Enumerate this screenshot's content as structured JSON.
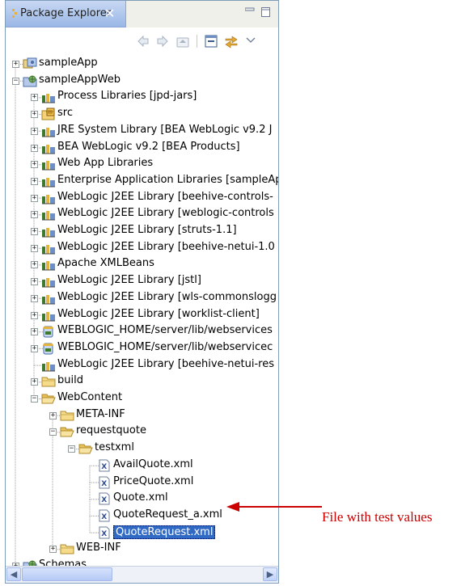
{
  "view": {
    "title": "Package Explorer",
    "close_glyph": "✕"
  },
  "colors": {
    "selection": "#316ac5",
    "annotation": "#cc0000",
    "folder": "#e9c15b",
    "library": "#3d7a2c"
  },
  "toolbar": {
    "icons": [
      "back-arrow-icon",
      "forward-arrow-icon",
      "up-folder-icon",
      "collapse-all-icon",
      "link-with-editor-icon",
      "view-menu-icon"
    ]
  },
  "tree": {
    "items": [
      {
        "label": "sampleApp",
        "depth": 0,
        "expander": "+",
        "icon": "ear-project-icon"
      },
      {
        "label": "sampleAppWeb",
        "depth": 0,
        "expander": "-",
        "icon": "web-project-icon"
      },
      {
        "label": "Process Libraries [jpd-jars]",
        "depth": 1,
        "expander": "+",
        "icon": "library-icon"
      },
      {
        "label": "src",
        "depth": 1,
        "expander": "+",
        "icon": "source-folder-icon"
      },
      {
        "label": "JRE System Library [BEA WebLogic v9.2 J",
        "depth": 1,
        "expander": "+",
        "icon": "library-icon"
      },
      {
        "label": "BEA WebLogic v9.2 [BEA Products]",
        "depth": 1,
        "expander": "+",
        "icon": "library-icon"
      },
      {
        "label": "Web App Libraries",
        "depth": 1,
        "expander": "+",
        "icon": "library-icon"
      },
      {
        "label": "Enterprise Application Libraries [sampleAp",
        "depth": 1,
        "expander": "+",
        "icon": "library-icon"
      },
      {
        "label": "WebLogic J2EE Library [beehive-controls-",
        "depth": 1,
        "expander": "+",
        "icon": "library-icon"
      },
      {
        "label": "WebLogic J2EE Library [weblogic-controls",
        "depth": 1,
        "expander": "+",
        "icon": "library-icon"
      },
      {
        "label": "WebLogic J2EE Library [struts-1.1]",
        "depth": 1,
        "expander": "+",
        "icon": "library-icon"
      },
      {
        "label": "WebLogic J2EE Library [beehive-netui-1.0",
        "depth": 1,
        "expander": "+",
        "icon": "library-icon"
      },
      {
        "label": "Apache XMLBeans",
        "depth": 1,
        "expander": "+",
        "icon": "library-icon"
      },
      {
        "label": "WebLogic J2EE Library [jstl]",
        "depth": 1,
        "expander": "+",
        "icon": "library-icon"
      },
      {
        "label": "WebLogic J2EE Library [wls-commonslogg",
        "depth": 1,
        "expander": "+",
        "icon": "library-icon"
      },
      {
        "label": "WebLogic J2EE Library [worklist-client]",
        "depth": 1,
        "expander": "+",
        "icon": "library-icon"
      },
      {
        "label": "WEBLOGIC_HOME/server/lib/webservices",
        "depth": 1,
        "expander": "+",
        "icon": "jar-icon"
      },
      {
        "label": "WEBLOGIC_HOME/server/lib/webservicec",
        "depth": 1,
        "expander": "+",
        "icon": "jar-icon"
      },
      {
        "label": "WebLogic J2EE Library [beehive-netui-res",
        "depth": 1,
        "expander": "",
        "icon": "library-icon"
      },
      {
        "label": "build",
        "depth": 1,
        "expander": "+",
        "icon": "folder-icon"
      },
      {
        "label": "WebContent",
        "depth": 1,
        "expander": "-",
        "icon": "folder-open-icon"
      },
      {
        "label": "META-INF",
        "depth": 2,
        "expander": "+",
        "icon": "folder-icon"
      },
      {
        "label": "requestquote",
        "depth": 2,
        "expander": "-",
        "icon": "folder-open-icon"
      },
      {
        "label": "testxml",
        "depth": 3,
        "expander": "-",
        "icon": "folder-open-icon"
      },
      {
        "label": "AvailQuote.xml",
        "depth": 4,
        "expander": "",
        "icon": "xml-file-icon"
      },
      {
        "label": "PriceQuote.xml",
        "depth": 4,
        "expander": "",
        "icon": "xml-file-icon"
      },
      {
        "label": "Quote.xml",
        "depth": 4,
        "expander": "",
        "icon": "xml-file-icon"
      },
      {
        "label": "QuoteRequest_a.xml",
        "depth": 4,
        "expander": "",
        "icon": "xml-file-icon"
      },
      {
        "label": "QuoteRequest.xml",
        "depth": 4,
        "expander": "",
        "icon": "xml-file-icon",
        "selected": true
      },
      {
        "label": "WEB-INF",
        "depth": 2,
        "expander": "+",
        "icon": "folder-icon"
      },
      {
        "label": "Schemas",
        "depth": 0,
        "expander": "+",
        "icon": "web-project-icon"
      }
    ]
  },
  "annotation": {
    "text": "File with test values"
  }
}
